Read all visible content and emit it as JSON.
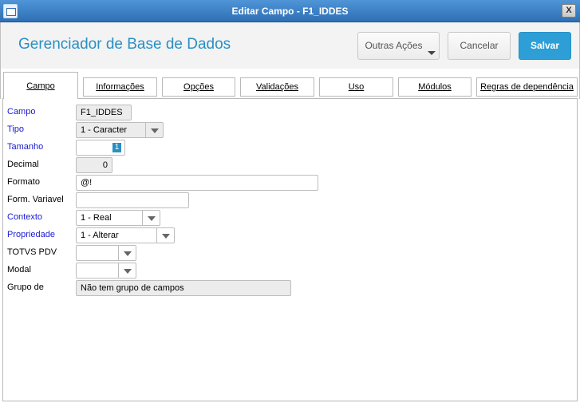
{
  "window": {
    "title": "Editar Campo - F1_IDDES",
    "close_label": "X"
  },
  "header": {
    "app_title": "Gerenciador de Base de Dados",
    "other_actions_label": "Outras Ações",
    "cancel_label": "Cancelar",
    "save_label": "Salvar",
    "save_color": "#2d9fd6"
  },
  "tabs": [
    {
      "label": "Campo",
      "active": true
    },
    {
      "label": "Informações",
      "active": false
    },
    {
      "label": "Opções",
      "active": false
    },
    {
      "label": "Validações",
      "active": false
    },
    {
      "label": "Uso",
      "active": false
    },
    {
      "label": "Módulos",
      "active": false
    },
    {
      "label": "Regras de dependência",
      "active": false
    }
  ],
  "form": {
    "campo": {
      "label": "Campo",
      "value": "F1_IDDES"
    },
    "tipo": {
      "label": "Tipo",
      "value": "1 - Caracter"
    },
    "tamanho": {
      "label": "Tamanho",
      "value": "1"
    },
    "decimal": {
      "label": "Decimal",
      "value": "0"
    },
    "formato": {
      "label": "Formato",
      "value": "@!"
    },
    "form_variavel": {
      "label": "Form. Variavel",
      "value": ""
    },
    "contexto": {
      "label": "Contexto",
      "value": "1 - Real"
    },
    "propriedade": {
      "label": "Propriedade",
      "value": "1 - Alterar"
    },
    "totvs_pdv": {
      "label": "TOTVS PDV",
      "value": ""
    },
    "modal": {
      "label": "Modal",
      "value": ""
    },
    "grupo": {
      "label": "Grupo de",
      "value": "Não tem grupo de campos"
    }
  }
}
